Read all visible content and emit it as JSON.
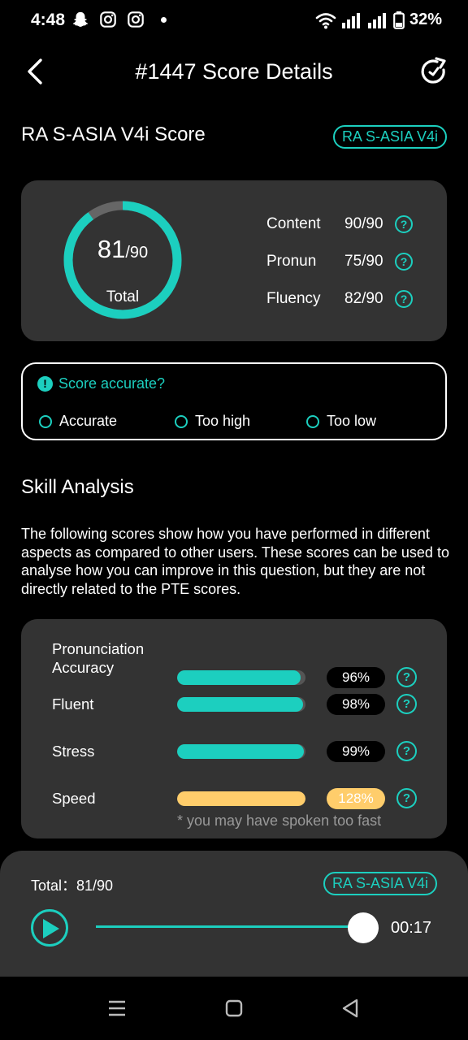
{
  "status_bar": {
    "time": "4:48",
    "battery": "32%",
    "icons": [
      "snapchat-icon",
      "instagram-icon",
      "instagram-icon",
      "wifi-icon",
      "signal-icon",
      "signal-icon",
      "battery-icon"
    ]
  },
  "header": {
    "title": "#1447 Score Details"
  },
  "score_section": {
    "title": "RA S-ASIA V4i Score",
    "tag": "RA S-ASIA V4i",
    "total_score": "81",
    "total_max": "/90",
    "total_label": "Total",
    "total_fraction": 0.9,
    "rows": [
      {
        "label": "Content",
        "value": "90/90"
      },
      {
        "label": "Pronun",
        "value": "75/90"
      },
      {
        "label": "Fluency",
        "value": "82/90"
      }
    ]
  },
  "accuracy": {
    "question": "Score accurate?",
    "options": [
      "Accurate",
      "Too high",
      "Too low"
    ]
  },
  "skill_analysis": {
    "title": "Skill Analysis",
    "description": "The following scores show how you have performed in different aspects as compared to other users. These scores can be used to analyse how you can improve in this question, but they are not directly related to the PTE scores.",
    "skills": [
      {
        "name": "Pronunciation Accuracy",
        "percent": "96%",
        "level": 0.96,
        "color": "#1ccfbf"
      },
      {
        "name": "Fluent",
        "percent": "98%",
        "level": 0.98,
        "color": "#1ccfbf"
      },
      {
        "name": "Stress",
        "percent": "99%",
        "level": 0.99,
        "color": "#1ccfbf"
      },
      {
        "name": "Speed",
        "percent": "128%",
        "level": 1.0,
        "color": "#ffcd6b"
      }
    ],
    "speed_note": "* you may have spoken too fast"
  },
  "player": {
    "total": "Total：81/90",
    "tag": "RA S-ASIA V4i",
    "time": "00:17",
    "progress": 0.95
  },
  "colors": {
    "accent": "#1ccfbf",
    "warning": "#ffcd6b",
    "card": "#333333",
    "background": "#000000"
  }
}
